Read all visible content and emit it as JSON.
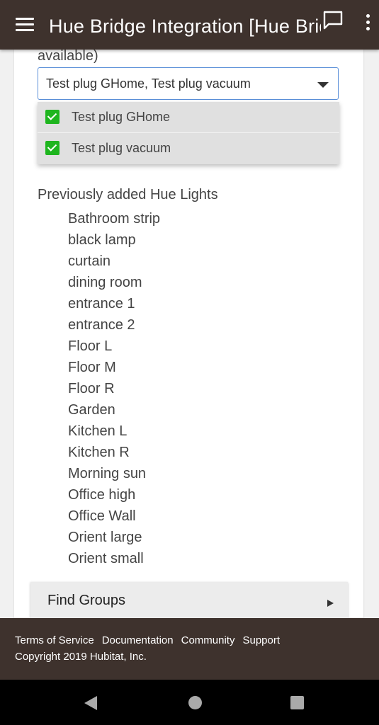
{
  "appbar": {
    "title": "Hue Bridge Integration [Hue Bridge]",
    "icons": [
      "menu-icon",
      "chat-icon",
      "more-vert-icon"
    ]
  },
  "plugs": {
    "available_text": "available)",
    "selected_value": "Test plug GHome, Test plug vacuum",
    "options": [
      {
        "label": "Test plug GHome",
        "checked": true
      },
      {
        "label": "Test plug vacuum",
        "checked": true
      }
    ]
  },
  "lights": {
    "title": "Previously added Hue Lights",
    "items": [
      "Bathroom strip",
      "black lamp",
      "curtain",
      "dining room",
      "entrance 1",
      "entrance 2",
      "Floor L",
      "Floor M",
      "Floor R",
      "Garden",
      "Kitchen L",
      "Kitchen R",
      "Morning sun",
      "Office high",
      "Office Wall",
      "Orient large",
      "Orient small"
    ]
  },
  "find_groups": {
    "label": "Find Groups"
  },
  "footer": {
    "links": [
      "Terms of Service",
      "Documentation",
      "Community",
      "Support"
    ],
    "copyright": "Copyright 2019 Hubitat, Inc."
  },
  "colors": {
    "appbar_bg": "#3e322d",
    "checkbox_green": "#1eb51e",
    "select_border": "#5a8fd8"
  }
}
